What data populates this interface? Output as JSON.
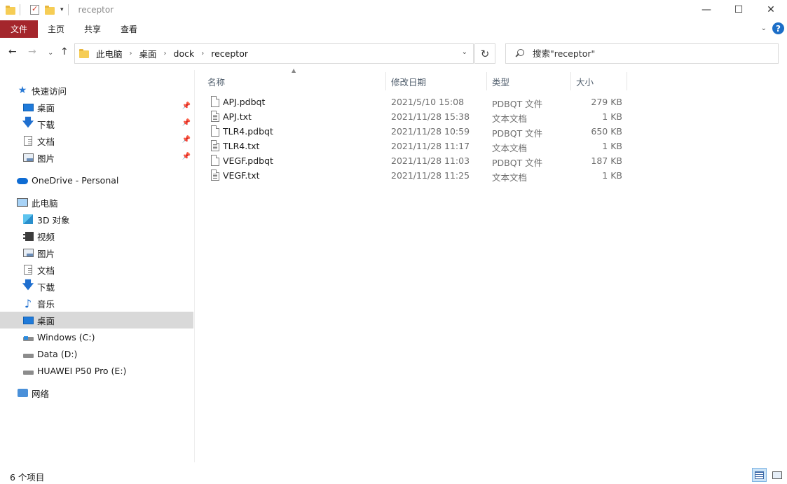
{
  "window": {
    "title": "receptor",
    "controls": {
      "minimize": "—",
      "maximize": "☐",
      "close": "✕"
    }
  },
  "ribbon": {
    "tabs": [
      "文件",
      "主页",
      "共享",
      "查看"
    ],
    "help_label": "?"
  },
  "address": {
    "breadcrumbs": [
      "此电脑",
      "桌面",
      "dock",
      "receptor"
    ]
  },
  "search": {
    "placeholder": "搜索\"receptor\""
  },
  "nav_pane": {
    "items": [
      {
        "label": "快速访问",
        "icon": "star-icon"
      },
      {
        "label": "桌面",
        "icon": "desktop-icon",
        "pinned": true
      },
      {
        "label": "下载",
        "icon": "download-icon",
        "pinned": true
      },
      {
        "label": "文档",
        "icon": "document-icon",
        "pinned": true
      },
      {
        "label": "图片",
        "icon": "picture-icon",
        "pinned": true
      },
      {
        "label": "OneDrive - Personal",
        "icon": "cloud-icon"
      },
      {
        "label": "此电脑",
        "icon": "computer-icon"
      },
      {
        "label": "3D 对象",
        "icon": "3d-objects-icon"
      },
      {
        "label": "视频",
        "icon": "video-icon"
      },
      {
        "label": "图片",
        "icon": "picture-icon"
      },
      {
        "label": "文档",
        "icon": "document-icon"
      },
      {
        "label": "下载",
        "icon": "download-icon"
      },
      {
        "label": "音乐",
        "icon": "music-icon"
      },
      {
        "label": "桌面",
        "icon": "desktop-icon",
        "selected": true
      },
      {
        "label": "Windows (C:)",
        "icon": "windows-drive-icon"
      },
      {
        "label": "Data (D:)",
        "icon": "drive-icon"
      },
      {
        "label": "HUAWEI P50 Pro (E:)",
        "icon": "drive-icon"
      },
      {
        "label": "网络",
        "icon": "network-icon"
      }
    ]
  },
  "columns": {
    "name": "名称",
    "date": "修改日期",
    "type": "类型",
    "size": "大小"
  },
  "files": [
    {
      "name": "APJ.pdbqt",
      "date": "2021/5/10 15:08",
      "type": "PDBQT 文件",
      "size": "279 KB",
      "kind": "generic"
    },
    {
      "name": "APJ.txt",
      "date": "2021/11/28 15:38",
      "type": "文本文档",
      "size": "1 KB",
      "kind": "txt"
    },
    {
      "name": "TLR4.pdbqt",
      "date": "2021/11/28 10:59",
      "type": "PDBQT 文件",
      "size": "650 KB",
      "kind": "generic"
    },
    {
      "name": "TLR4.txt",
      "date": "2021/11/28 11:17",
      "type": "文本文档",
      "size": "1 KB",
      "kind": "txt"
    },
    {
      "name": "VEGF.pdbqt",
      "date": "2021/11/28 11:03",
      "type": "PDBQT 文件",
      "size": "187 KB",
      "kind": "generic"
    },
    {
      "name": "VEGF.txt",
      "date": "2021/11/28 11:25",
      "type": "文本文档",
      "size": "1 KB",
      "kind": "txt"
    }
  ],
  "status": {
    "item_count": "6 个项目"
  },
  "colors": {
    "file_tab": "#a4262c",
    "selection": "#d9d9d9",
    "accent": "#1c6ec7"
  }
}
